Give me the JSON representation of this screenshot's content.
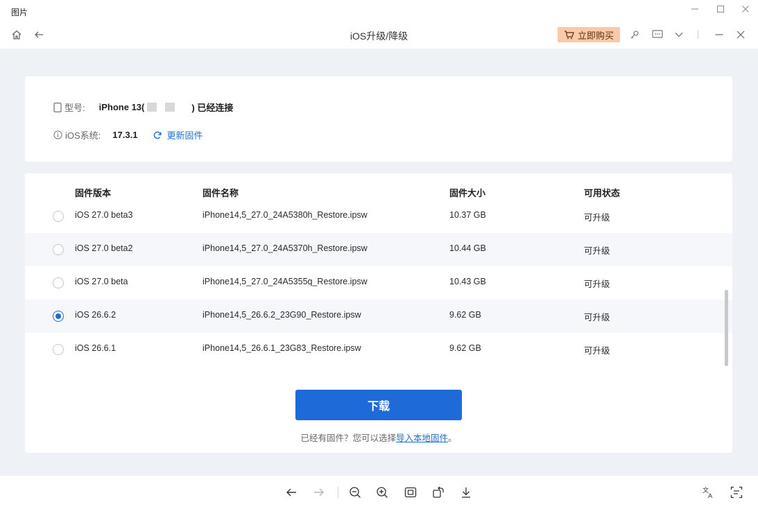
{
  "viewer": {
    "title": "图片"
  },
  "app": {
    "title": "iOS升级/降级",
    "buy_label": "立即购买"
  },
  "device": {
    "model_label": "型号:",
    "model_value_prefix": "iPhone 13(",
    "model_value_suffix": ") 已经连接",
    "ios_label": "iOS系统:",
    "ios_value": "17.3.1",
    "update_label": "更新固件"
  },
  "table": {
    "headers": [
      "固件版本",
      "固件名称",
      "固件大小",
      "可用状态"
    ],
    "rows": [
      {
        "version": "iOS 27.0 beta3",
        "name": "iPhone14,5_27.0_24A5380h_Restore.ipsw",
        "size": "10.37 GB",
        "status": "可升级",
        "selected": false
      },
      {
        "version": "iOS 27.0 beta2",
        "name": "iPhone14,5_27.0_24A5370h_Restore.ipsw",
        "size": "10.44 GB",
        "status": "可升级",
        "selected": false
      },
      {
        "version": "iOS 27.0 beta",
        "name": "iPhone14,5_27.0_24A5355q_Restore.ipsw",
        "size": "10.43 GB",
        "status": "可升级",
        "selected": false
      },
      {
        "version": "iOS 26.6.2",
        "name": "iPhone14,5_26.6.2_23G90_Restore.ipsw",
        "size": "9.62 GB",
        "status": "可升级",
        "selected": true
      },
      {
        "version": "iOS 26.6.1",
        "name": "iPhone14,5_26.6.1_23G83_Restore.ipsw",
        "size": "9.62 GB",
        "status": "可升级",
        "selected": false
      }
    ]
  },
  "actions": {
    "download_label": "下载",
    "hint_text": "已经有固件？您可以选择",
    "hint_link": "导入本地固件",
    "hint_end": "。"
  },
  "colors": {
    "accent": "#1e6ad8",
    "buy_bg": "#f9c9a8",
    "main_bg": "#eef1f6"
  }
}
